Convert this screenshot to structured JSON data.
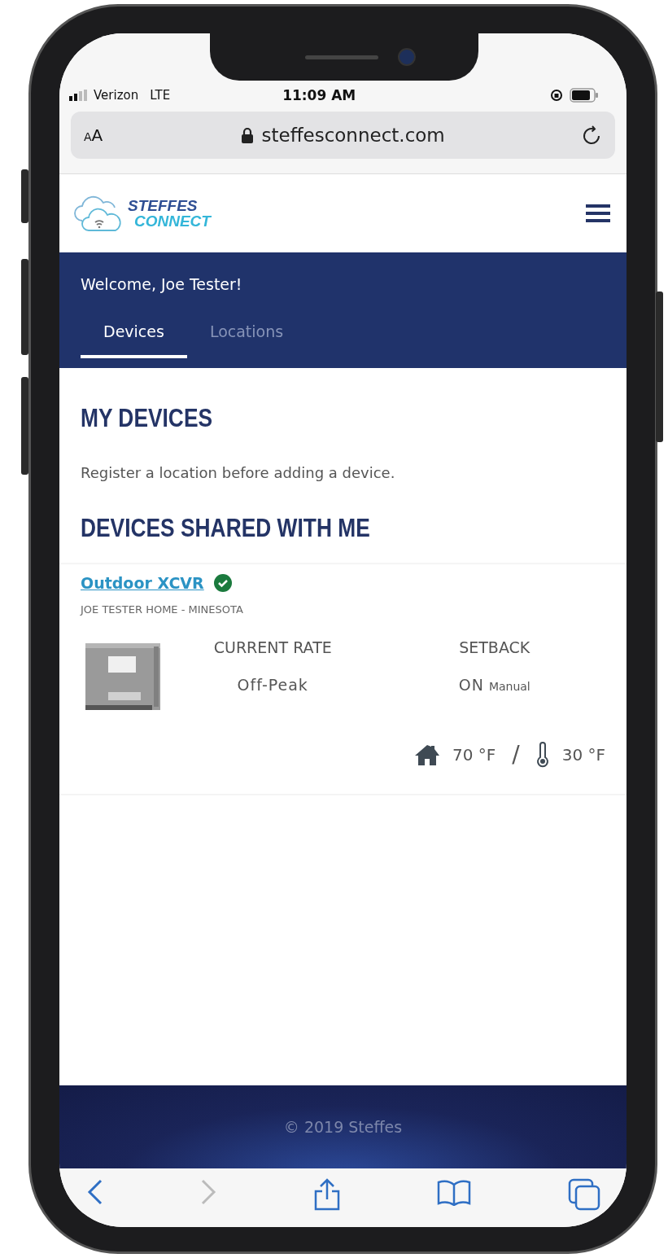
{
  "status_bar": {
    "carrier": "Verizon",
    "network": "LTE",
    "time": "11:09 AM"
  },
  "address_bar": {
    "text_size": "AA",
    "url": "steffesconnect.com"
  },
  "header": {
    "logo_line_1": "STEFFES",
    "logo_line_2": "CONNECT"
  },
  "banner": {
    "welcome": "Welcome, Joe Tester!"
  },
  "tabs": [
    {
      "label": "Devices",
      "selected": true
    },
    {
      "label": "Locations",
      "selected": false
    }
  ],
  "my_devices": {
    "heading": "MY DEVICES",
    "message": "Register a location before adding a device."
  },
  "shared": {
    "heading": "DEVICES SHARED WITH ME"
  },
  "devices": [
    {
      "name": "Outdoor XCVR",
      "online": true,
      "location": "JOE TESTER HOME - MINESOTA",
      "stats": [
        {
          "label": "CURRENT RATE",
          "value": "Off-Peak"
        },
        {
          "label": "SETBACK",
          "value": "ON",
          "note": "Manual"
        }
      ],
      "indoor_temp": "70 °F",
      "separator": "/",
      "outdoor_temp": "30 °F"
    }
  ],
  "footer": {
    "copyright": "© 2019 Steffes"
  },
  "toolbar": [
    {
      "kind": "back",
      "disabled": false
    },
    {
      "kind": "forward",
      "disabled": true
    },
    {
      "kind": "share",
      "disabled": false
    },
    {
      "kind": "bookmarks",
      "disabled": false
    },
    {
      "kind": "tabs",
      "disabled": false
    }
  ]
}
